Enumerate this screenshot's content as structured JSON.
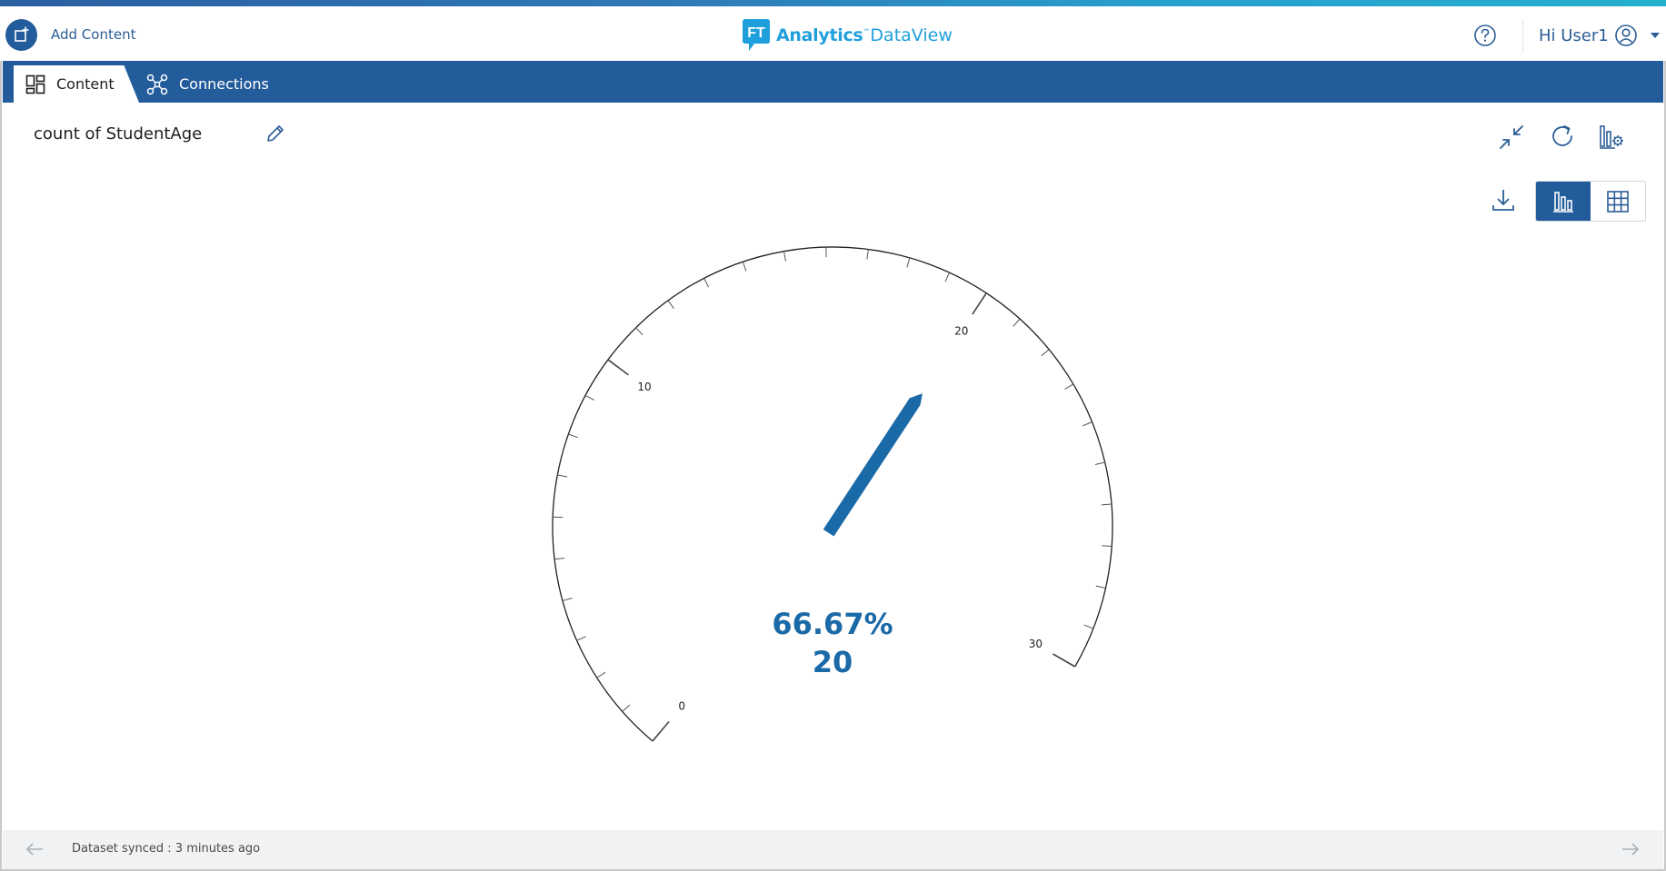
{
  "header": {
    "add_content_label": "Add Content",
    "logo_badge": "FT",
    "logo_name": "Analytics",
    "logo_tm": "™",
    "logo_product": "DataView",
    "user_greeting": "Hi User1"
  },
  "nav": {
    "tabs": [
      {
        "label": "Content",
        "icon": "dashboard-grid-icon",
        "active": true
      },
      {
        "label": "Connections",
        "icon": "network-icon",
        "active": false
      }
    ]
  },
  "widget": {
    "title": "count of StudentAge",
    "view_mode": "chart"
  },
  "chart_data": {
    "type": "gauge",
    "min": 0,
    "max": 30,
    "value": 20,
    "percent_label": "66.67%",
    "value_label": "20",
    "major_ticks": [
      "0",
      "10",
      "20",
      "30"
    ],
    "minor_tick_step": 1
  },
  "footer": {
    "status": "Dataset synced : 3 minutes ago"
  },
  "colors": {
    "brand_blue": "#235c9b",
    "accent_blue": "#1b6aa8",
    "logo_blue": "#1f9fdc"
  }
}
